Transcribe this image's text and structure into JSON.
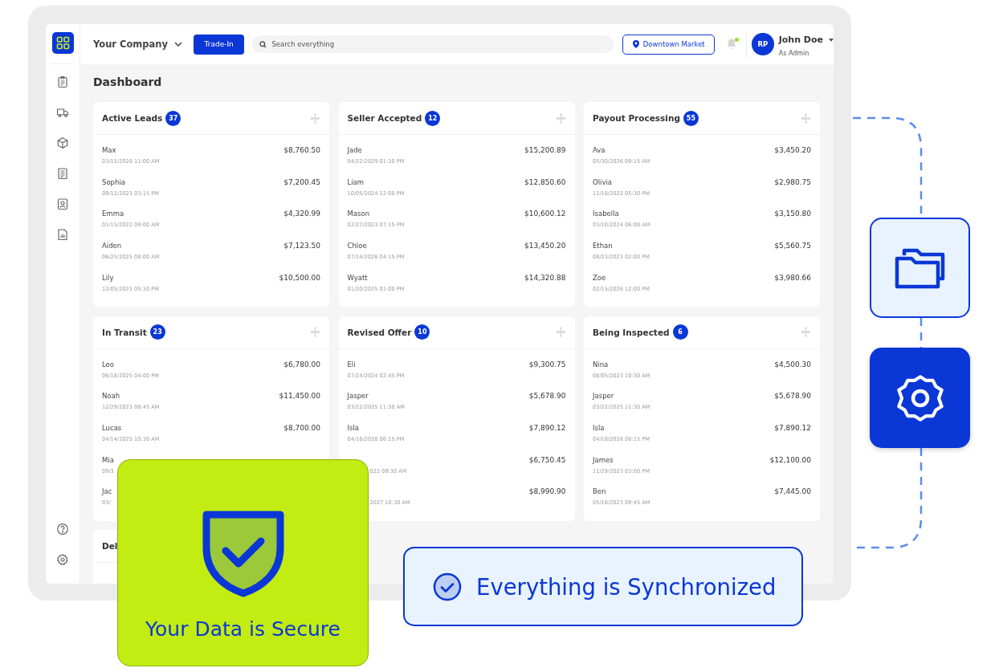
{
  "topbar": {
    "company": "Your Company",
    "trade_in_button": "Trade-In",
    "search": {
      "placeholder": "Search everything"
    },
    "location_button": "Downtown Market",
    "notifications": {
      "unread": true
    },
    "user": {
      "initials": "RP",
      "name": "John Doe",
      "role": "As Admin"
    }
  },
  "page_title": "Dashboard",
  "cards": [
    {
      "title": "Active Leads",
      "count": "37",
      "rows": [
        {
          "kind": "full",
          "name": "Max",
          "date": "03/15/2028 11:00 AM",
          "amount": "$8,760.50"
        },
        {
          "kind": "full",
          "name": "Sophia",
          "date": "09/12/2023 03:15 PM",
          "amount": "$7,200.45"
        },
        {
          "kind": "full",
          "name": "Emma",
          "date": "01/15/2022 09:00 AM",
          "amount": "$4,320.99"
        },
        {
          "kind": "full",
          "name": "Aiden",
          "date": "06/25/2025 08:00 AM",
          "amount": "$7,123.50"
        },
        {
          "kind": "full",
          "name": "Lily",
          "date": "12/05/2023 05:30 PM",
          "amount": "$10,500.00"
        }
      ]
    },
    {
      "title": "Seller Accepted",
      "count": "12",
      "rows": [
        {
          "kind": "full",
          "name": "Jade",
          "date": "04/22/2029 01:30 PM",
          "amount": "$15,200.89"
        },
        {
          "kind": "full",
          "name": "Liam",
          "date": "10/05/2024 12:00 PM",
          "amount": "$12,850.60"
        },
        {
          "kind": "full",
          "name": "Mason",
          "date": "02/27/2023 07:15 PM",
          "amount": "$10,600.12"
        },
        {
          "kind": "full",
          "name": "Chloe",
          "date": "07/14/2026 04:15 PM",
          "amount": "$13,450.20"
        },
        {
          "kind": "full",
          "name": "Wyatt",
          "date": "01/20/2025 01:00 PM",
          "amount": "$14,320.88"
        }
      ]
    },
    {
      "title": "Payout Processing",
      "count": "55",
      "rows": [
        {
          "kind": "full",
          "name": "Ava",
          "date": "05/30/2026 09:15 AM",
          "amount": "$3,450.20"
        },
        {
          "kind": "full",
          "name": "Olivia",
          "date": "11/18/2022 05:30 PM",
          "amount": "$2,980.75"
        },
        {
          "kind": "full",
          "name": "Isabella",
          "date": "03/10/2024 06:00 AM",
          "amount": "$3,150.80"
        },
        {
          "kind": "full",
          "name": "Ethan",
          "date": "08/23/2023 02:00 PM",
          "amount": "$5,560.75"
        },
        {
          "kind": "full",
          "name": "Zoe",
          "date": "02/15/2026 12:00 PM",
          "amount": "$3,980.66"
        }
      ]
    },
    {
      "title": "In Transit",
      "count": "23",
      "rows": [
        {
          "kind": "full",
          "name": "Leo",
          "date": "06/18/2025 04:00 PM",
          "amount": "$6,780.00"
        },
        {
          "kind": "full",
          "name": "Noah",
          "date": "12/29/2023 08:45 AM",
          "amount": "$11,450.00"
        },
        {
          "kind": "full",
          "name": "Lucas",
          "date": "04/14/2025 10:30 AM",
          "amount": "$8,700.00"
        },
        {
          "kind": "left",
          "name": "Mia",
          "date": "09/3"
        },
        {
          "kind": "left",
          "name": "Jac",
          "date": "03/"
        }
      ]
    },
    {
      "title": "Revised Offer",
      "count": "10",
      "rows": [
        {
          "kind": "full",
          "name": "Eli",
          "date": "07/24/2024 02:45 PM",
          "amount": "$9,300.75"
        },
        {
          "kind": "full",
          "name": "Jasper",
          "date": "03/22/2025 11:30 AM",
          "amount": "$5,678.90"
        },
        {
          "kind": "full",
          "name": "Isla",
          "date": "04/18/2028 06:15 PM",
          "amount": "$7,890.12"
        },
        {
          "kind": "right",
          "date": "022 09:30 AM",
          "amount": "$6,750.45"
        },
        {
          "kind": "right",
          "date": "2027 10:30 AM",
          "amount": "$8,990.90"
        }
      ]
    },
    {
      "title": "Being Inspected",
      "count": "6",
      "rows": [
        {
          "kind": "full",
          "name": "Nina",
          "date": "08/05/2023 10:30 AM",
          "amount": "$4,500.30"
        },
        {
          "kind": "full",
          "name": "Jasper",
          "date": "03/22/2025 11:30 AM",
          "amount": "$5,678.90"
        },
        {
          "kind": "full",
          "name": "Isla",
          "date": "04/18/2028 06:15 PM",
          "amount": "$7,890.12"
        },
        {
          "kind": "full",
          "name": "James",
          "date": "11/29/2023 03:00 PM",
          "amount": "$12,100.00"
        },
        {
          "kind": "full",
          "name": "Ben",
          "date": "05/18/2023 09:45 AM",
          "amount": "$7,445.00"
        }
      ]
    },
    {
      "title": "Del"
    }
  ],
  "security_badge": {
    "text": "Your Data is Secure"
  },
  "sync_status": {
    "text": "Everything is Synchronized"
  }
}
